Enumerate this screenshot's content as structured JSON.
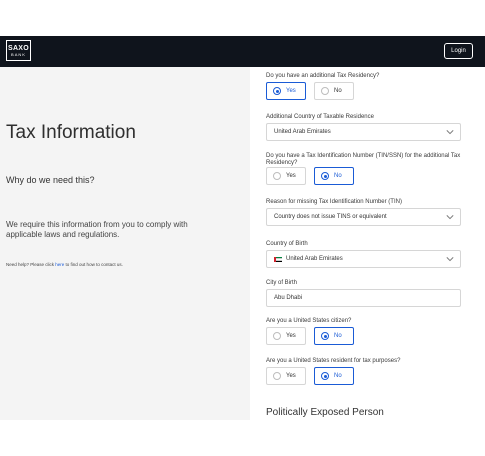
{
  "header": {
    "logo_line1": "SAXO",
    "logo_line2": "BANK",
    "login_label": "Login"
  },
  "left": {
    "title": "Tax Information",
    "why": "Why do we need this?",
    "description": "We require this information from you to comply with applicable laws and regulations.",
    "help_prefix": "Need help? Please click ",
    "help_link": "here",
    "help_suffix": " to find out how to contact us."
  },
  "form": {
    "q_additional_residency": "Do you have an additional Tax Residency?",
    "additional_residency": {
      "yes": "Yes",
      "no": "No",
      "selected": "Yes"
    },
    "q_additional_country": "Additional Country of Taxable Residence",
    "additional_country_value": "United Arab Emirates",
    "q_tin": "Do you have a Tax Identification Number (TIN/SSN) for the additional Tax Residency?",
    "tin": {
      "yes": "Yes",
      "no": "No",
      "selected": "No"
    },
    "q_reason": "Reason for missing Tax Identification Number (TIN)",
    "reason_value": "Country does not issue TINS or equivalent",
    "q_country_birth": "Country of Birth",
    "country_birth_value": "United Arab Emirates",
    "q_city_birth": "City of Birth",
    "city_birth_value": "Abu Dhabi",
    "q_us_citizen": "Are you a United States citizen?",
    "us_citizen": {
      "yes": "Yes",
      "no": "No",
      "selected": "No"
    },
    "q_us_resident": "Are you a United States resident for tax purposes?",
    "us_resident": {
      "yes": "Yes",
      "no": "No",
      "selected": "No"
    },
    "section_pep": "Politically Exposed Person"
  },
  "colors": {
    "header_bg": "#0f141c",
    "left_bg": "#f4f4f4",
    "accent": "#1a5bd6"
  }
}
